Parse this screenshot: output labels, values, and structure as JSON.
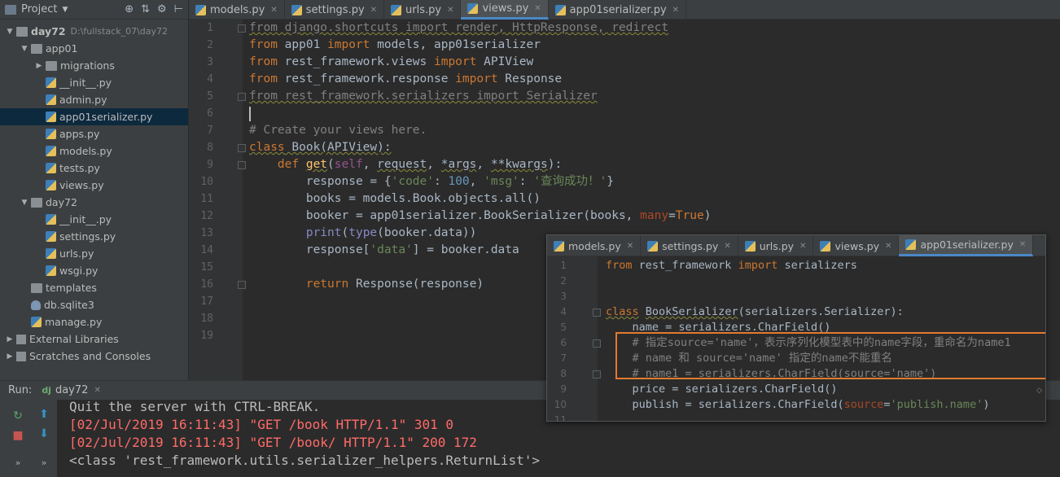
{
  "project": {
    "title": "Project",
    "tree": [
      {
        "label": "day72",
        "path": "D:\\fullstack_07\\day72",
        "depth": 0,
        "icon": "folder-icon",
        "open": true,
        "bold": true
      },
      {
        "label": "app01",
        "depth": 1,
        "icon": "folder-icon",
        "open": true
      },
      {
        "label": "migrations",
        "depth": 2,
        "icon": "folder-icon",
        "open": false
      },
      {
        "label": "__init__.py",
        "depth": 2,
        "icon": "python-file-icon"
      },
      {
        "label": "admin.py",
        "depth": 2,
        "icon": "python-file-icon"
      },
      {
        "label": "app01serializer.py",
        "depth": 2,
        "icon": "python-file-icon",
        "selected": true
      },
      {
        "label": "apps.py",
        "depth": 2,
        "icon": "python-file-icon"
      },
      {
        "label": "models.py",
        "depth": 2,
        "icon": "python-file-icon"
      },
      {
        "label": "tests.py",
        "depth": 2,
        "icon": "python-file-icon"
      },
      {
        "label": "views.py",
        "depth": 2,
        "icon": "python-file-icon"
      },
      {
        "label": "day72",
        "depth": 1,
        "icon": "folder-icon",
        "open": true
      },
      {
        "label": "__init__.py",
        "depth": 2,
        "icon": "python-file-icon"
      },
      {
        "label": "settings.py",
        "depth": 2,
        "icon": "python-file-icon"
      },
      {
        "label": "urls.py",
        "depth": 2,
        "icon": "python-file-icon"
      },
      {
        "label": "wsgi.py",
        "depth": 2,
        "icon": "python-file-icon"
      },
      {
        "label": "templates",
        "depth": 1,
        "icon": "folder-icon"
      },
      {
        "label": "db.sqlite3",
        "depth": 1,
        "icon": "database-icon"
      },
      {
        "label": "manage.py",
        "depth": 1,
        "icon": "python-file-icon"
      },
      {
        "label": "External Libraries",
        "depth": 0,
        "icon": "library-icon",
        "open": false
      },
      {
        "label": "Scratches and Consoles",
        "depth": 0,
        "icon": "scratches-icon",
        "open": false
      }
    ]
  },
  "editor": {
    "tabs": [
      {
        "label": "models.py",
        "active": false
      },
      {
        "label": "settings.py",
        "active": false
      },
      {
        "label": "urls.py",
        "active": false
      },
      {
        "label": "views.py",
        "active": true
      },
      {
        "label": "app01serializer.py",
        "active": false
      }
    ],
    "line_numbers": [
      "1",
      "2",
      "3",
      "4",
      "5",
      "6",
      "7",
      "8",
      "9",
      "10",
      "11",
      "12",
      "13",
      "14",
      "15",
      "16",
      "17",
      "18",
      "19"
    ],
    "lines": [
      [
        {
          "t": "from django.shortcuts import render, HttpResponse, redirect",
          "c": "cm squig"
        }
      ],
      [
        {
          "t": "from",
          "c": "kw"
        },
        {
          "t": " app01 ",
          "c": "ident"
        },
        {
          "t": "import",
          "c": "kw"
        },
        {
          "t": " models, app01serializer",
          "c": "ident"
        }
      ],
      [
        {
          "t": "from",
          "c": "kw"
        },
        {
          "t": " rest_framework.views ",
          "c": "ident"
        },
        {
          "t": "import",
          "c": "kw"
        },
        {
          "t": " APIView",
          "c": "ident"
        }
      ],
      [
        {
          "t": "from",
          "c": "kw"
        },
        {
          "t": " rest_framework.response ",
          "c": "ident"
        },
        {
          "t": "import",
          "c": "kw"
        },
        {
          "t": " Response",
          "c": "ident"
        }
      ],
      [
        {
          "t": "from rest_framework.serializers import Serializer",
          "c": "cm squig"
        }
      ],
      [],
      [
        {
          "t": "# Create your views here.",
          "c": "cm"
        }
      ],
      [
        {
          "t": "class",
          "c": "kw squig"
        },
        {
          "t": " Book(APIView):",
          "c": "ident squig"
        }
      ],
      [
        {
          "t": "    def ",
          "c": "kw"
        },
        {
          "t": "get",
          "c": "fn squig"
        },
        {
          "t": "(",
          "c": "ident"
        },
        {
          "t": "self",
          "c": "self"
        },
        {
          "t": ", ",
          "c": "ident"
        },
        {
          "t": "request",
          "c": "ident squig"
        },
        {
          "t": ", ",
          "c": "ident"
        },
        {
          "t": "*args",
          "c": "ident squig"
        },
        {
          "t": ", ",
          "c": "ident"
        },
        {
          "t": "**kwargs",
          "c": "ident squig"
        },
        {
          "t": "):",
          "c": "ident"
        }
      ],
      [
        {
          "t": "        response = {",
          "c": "ident"
        },
        {
          "t": "'code'",
          "c": "str"
        },
        {
          "t": ": ",
          "c": "ident"
        },
        {
          "t": "100",
          "c": "num"
        },
        {
          "t": ", ",
          "c": "ident"
        },
        {
          "t": "'msg'",
          "c": "str"
        },
        {
          "t": ": ",
          "c": "ident"
        },
        {
          "t": "'查询成功！'",
          "c": "str"
        },
        {
          "t": "}",
          "c": "ident"
        }
      ],
      [
        {
          "t": "        books = models.Book.objects.all()",
          "c": "ident"
        }
      ],
      [
        {
          "t": "        booker = app01serializer.BookSerializer(books, ",
          "c": "ident"
        },
        {
          "t": "many",
          "c": "param"
        },
        {
          "t": "=",
          "c": "ident"
        },
        {
          "t": "True",
          "c": "kw"
        },
        {
          "t": ")",
          "c": "ident"
        }
      ],
      [
        {
          "t": "        ",
          "c": "ident"
        },
        {
          "t": "print",
          "c": "bi"
        },
        {
          "t": "(",
          "c": "ident"
        },
        {
          "t": "type",
          "c": "bi"
        },
        {
          "t": "(booker.data))",
          "c": "ident"
        }
      ],
      [
        {
          "t": "        response[",
          "c": "ident"
        },
        {
          "t": "'data'",
          "c": "str"
        },
        {
          "t": "] = booker.data",
          "c": "ident"
        }
      ],
      [],
      [
        {
          "t": "        ",
          "c": "ident"
        },
        {
          "t": "return",
          "c": "kw"
        },
        {
          "t": " Response(response)",
          "c": "ident"
        }
      ],
      [],
      [],
      []
    ]
  },
  "overlay": {
    "tabs": [
      {
        "label": "models.py",
        "active": false
      },
      {
        "label": "settings.py",
        "active": false
      },
      {
        "label": "urls.py",
        "active": false
      },
      {
        "label": "views.py",
        "active": false
      },
      {
        "label": "app01serializer.py",
        "active": true
      }
    ],
    "line_numbers": [
      "1",
      "2",
      "3",
      "4",
      "5",
      "6",
      "7",
      "8",
      "9",
      "10",
      "11"
    ],
    "lines": [
      [
        {
          "t": "from",
          "c": "kw"
        },
        {
          "t": " rest_framework ",
          "c": "ident"
        },
        {
          "t": "import",
          "c": "kw"
        },
        {
          "t": " serializers",
          "c": "ident"
        }
      ],
      [],
      [],
      [
        {
          "t": "class",
          "c": "kw squig"
        },
        {
          "t": " ",
          "c": "ident"
        },
        {
          "t": "BookSerializer",
          "c": "ident squig"
        },
        {
          "t": "(serializers.Serializer):",
          "c": "ident"
        }
      ],
      [
        {
          "t": "    name = serializers.CharField()",
          "c": "ident"
        }
      ],
      [
        {
          "t": "    # 指定source='name'，表示序列化模型表中的name字段，重命名为name1",
          "c": "cm"
        }
      ],
      [
        {
          "t": "    # name 和 source='name' 指定的name不能重名",
          "c": "cm"
        }
      ],
      [
        {
          "t": "    # name1 = serializers.CharField(source='name')",
          "c": "cm"
        }
      ],
      [
        {
          "t": "    price = serializers.CharField()",
          "c": "ident"
        }
      ],
      [
        {
          "t": "    publish = serializers.CharField(",
          "c": "ident"
        },
        {
          "t": "source",
          "c": "param"
        },
        {
          "t": "=",
          "c": "ident"
        },
        {
          "t": "'publish.name'",
          "c": "str"
        },
        {
          "t": ")",
          "c": "ident"
        }
      ],
      []
    ]
  },
  "run": {
    "label": "Run:",
    "config": "day72",
    "config_badge": "dj",
    "console": [
      {
        "text": "Quit the server with CTRL-BREAK.",
        "kind": "out"
      },
      {
        "text": "[02/Jul/2019 16:11:43] \"GET /book HTTP/1.1\" 301 0",
        "kind": "err"
      },
      {
        "text": "[02/Jul/2019 16:11:43] \"GET /book/ HTTP/1.1\" 200 172",
        "kind": "err"
      },
      {
        "text": "<class 'rest_framework.utils.serializer_helpers.ReturnList'>",
        "kind": "out"
      }
    ]
  }
}
